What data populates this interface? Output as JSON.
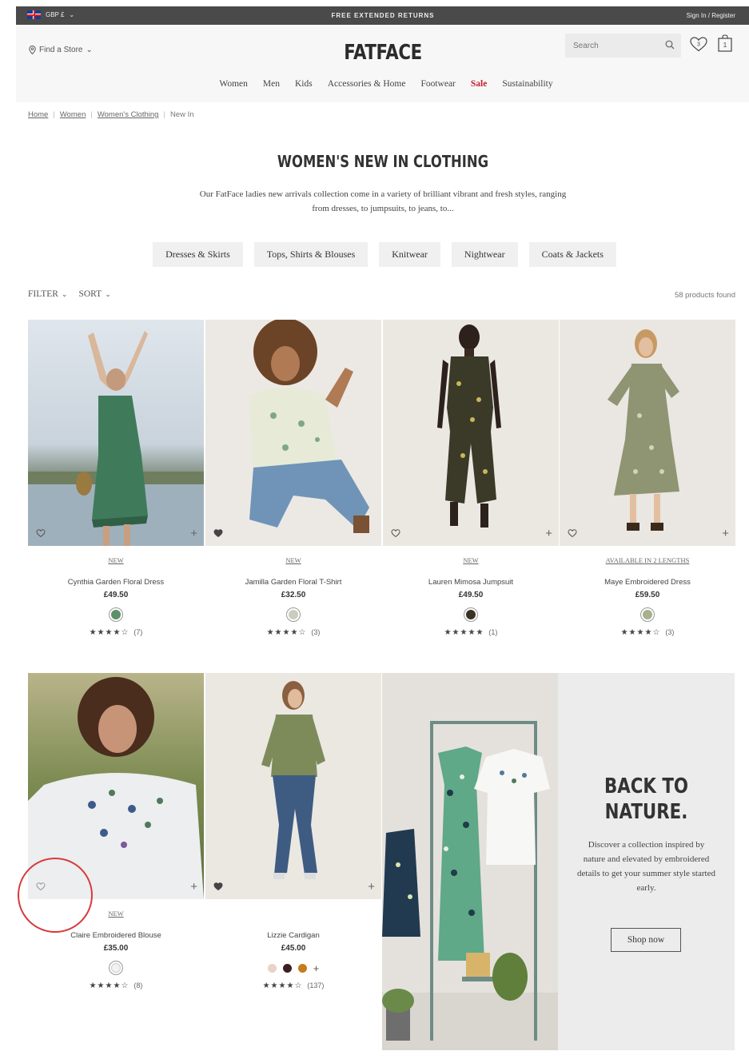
{
  "topbar": {
    "currency": "GBP £",
    "promo": "FREE EXTENDED RETURNS",
    "signin": "Sign In / Register"
  },
  "header": {
    "find_store": "Find a Store",
    "logo": "FATFACE",
    "search_placeholder": "Search",
    "wishlist_count": "3",
    "bag_count": "1"
  },
  "nav": [
    "Women",
    "Men",
    "Kids",
    "Accessories & Home",
    "Footwear",
    "Sale",
    "Sustainability"
  ],
  "breadcrumb": [
    "Home",
    "Women",
    "Women's Clothing",
    "New In"
  ],
  "page": {
    "title": "WOMEN'S NEW IN CLOTHING",
    "intro": "Our FatFace ladies new arrivals collection come in a variety of brilliant vibrant and fresh styles, ranging from dresses, to jumpsuits, to jeans, to..."
  },
  "categories": [
    "Dresses & Skirts",
    "Tops, Shirts & Blouses",
    "Knitwear",
    "Nightwear",
    "Coats & Jackets"
  ],
  "toolbar": {
    "filter": "FILTER",
    "sort": "SORT",
    "count": "58 products found"
  },
  "products": [
    {
      "badge": "NEW",
      "name": "Cynthia Garden Floral Dress",
      "price": "£49.50",
      "stars": "★★★★☆",
      "reviews": "(7)",
      "swatches": [
        "#5f8f6a"
      ]
    },
    {
      "badge": "NEW",
      "name": "Jamilla Garden Floral T-Shirt",
      "price": "£32.50",
      "stars": "★★★★☆",
      "reviews": "(3)",
      "swatches": [
        "#c9cdbd"
      ]
    },
    {
      "badge": "NEW",
      "name": "Lauren Mimosa Jumpsuit",
      "price": "£49.50",
      "stars": "★★★★★",
      "reviews": "(1)",
      "swatches": [
        "#3a3324"
      ]
    },
    {
      "badge": "AVAILABLE IN 2 LENGTHS",
      "name": "Maye Embroidered Dress",
      "price": "£59.50",
      "stars": "★★★★☆",
      "reviews": "(3)",
      "swatches": [
        "#a7b08f"
      ]
    },
    {
      "badge": "NEW",
      "name": "Claire Embroidered Blouse",
      "price": "£35.00",
      "stars": "★★★★☆",
      "reviews": "(8)",
      "swatches": [
        "#f2f2f2"
      ]
    },
    {
      "badge": "",
      "name": "Lizzie Cardigan",
      "price": "£45.00",
      "stars": "★★★★☆",
      "reviews": "(137)",
      "swatches": [
        "#e8d3c6",
        "#3b1f22",
        "#c87a1e"
      ]
    }
  ],
  "editorial": {
    "title_line1": "BACK TO",
    "title_line2": "NATURE.",
    "body": "Discover a collection inspired by nature and elevated by embroidered details to get your summer style started early.",
    "cta": "Shop now"
  },
  "colors": {
    "topbar_bg": "#4a4a4a",
    "sale_red": "#c41e2a",
    "annotation_red": "#d63a3a"
  }
}
